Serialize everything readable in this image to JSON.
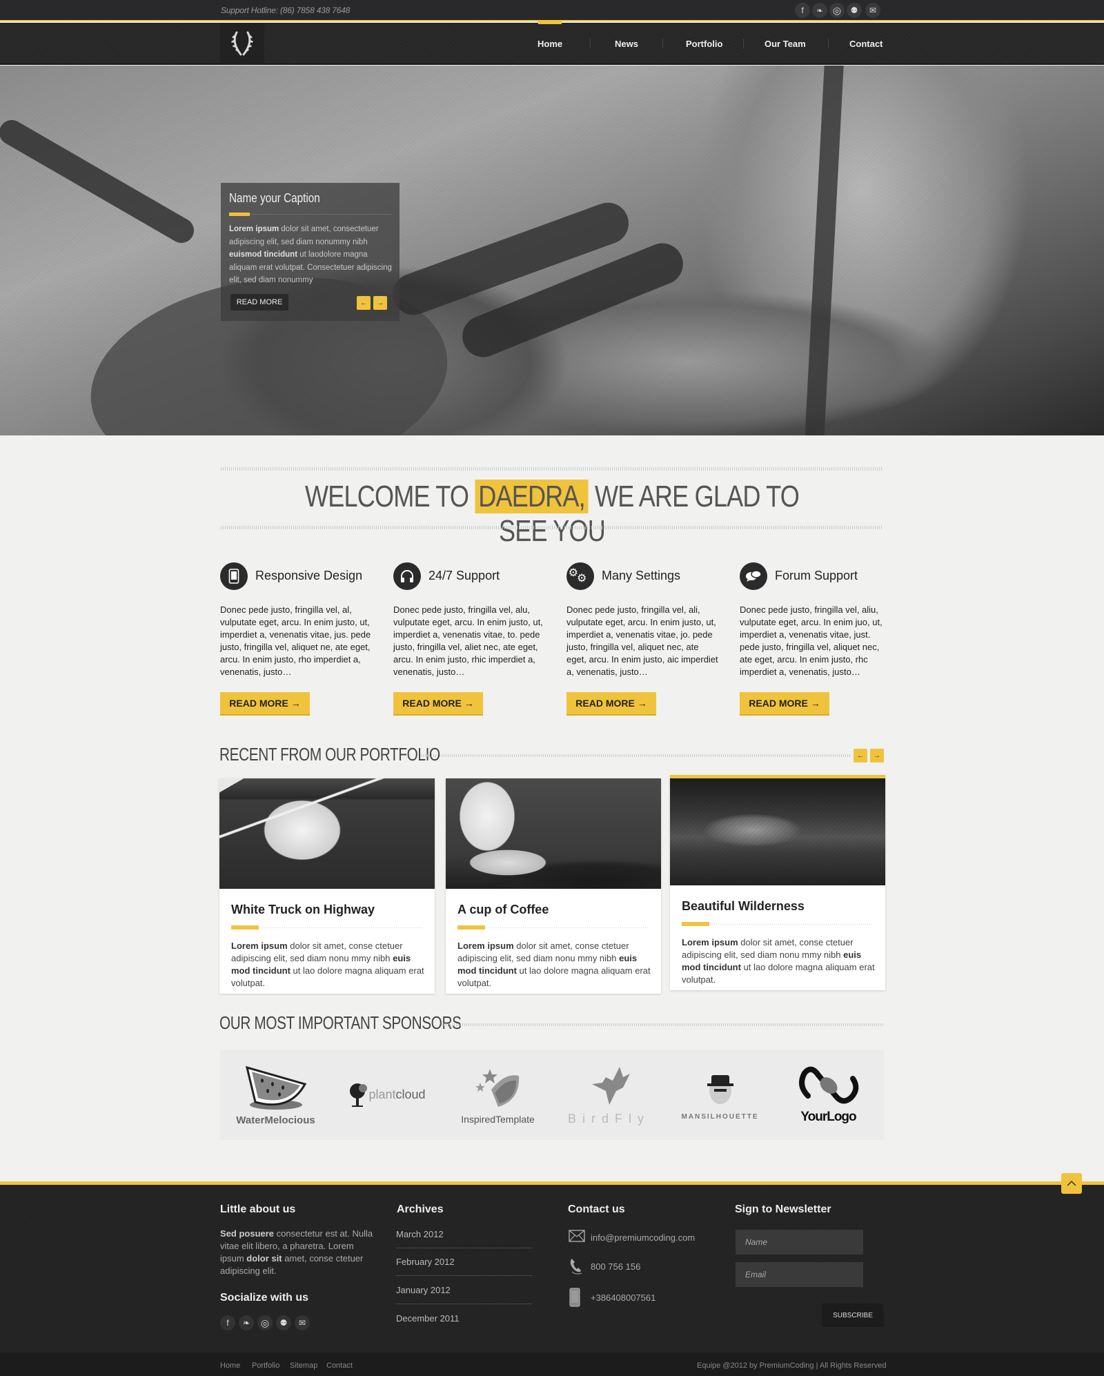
{
  "topbar": {
    "hotline": "Support Hotline: (86) 7858 438 7648",
    "social": [
      {
        "icon": "facebook-icon",
        "glyph": "f"
      },
      {
        "icon": "twitter-icon",
        "glyph": "🐦"
      },
      {
        "icon": "dribbble-icon",
        "glyph": "⊕"
      },
      {
        "icon": "forrst-icon",
        "glyph": "⚲"
      },
      {
        "icon": "email-icon",
        "glyph": "✉"
      }
    ]
  },
  "nav": {
    "logo": "laurel-logo",
    "items": [
      {
        "label": "Home",
        "active": true
      },
      {
        "label": "News",
        "active": false
      },
      {
        "label": "Portfolio",
        "active": false
      },
      {
        "label": "Our Team",
        "active": false
      },
      {
        "label": "Contact",
        "active": false
      }
    ]
  },
  "hero": {
    "caption_title": "Name your Caption",
    "caption_bold1": "Lorem ipsum",
    "caption_text1": " dolor sit amet, consectetuer adipiscing elit, sed diam nonummy nibh ",
    "caption_bold2": "euismod tincidunt",
    "caption_text2": " ut laodolore magna aliquam erat volutpat. Consectetuer adipiscing elit, sed diam nonummy",
    "read_more": "READ MORE",
    "prev": "←",
    "next": "→"
  },
  "welcome": {
    "pre": "WELCOME TO",
    "highlight": "DAEDRA,",
    "post": "WE ARE GLAD TO SEE YOU"
  },
  "features": [
    {
      "icon": "smartphone-icon",
      "glyph": "▯",
      "title": "Responsive Design",
      "text": "Donec pede justo, fringilla vel, al, vulputate eget, arcu. In enim justo, ut, imperdiet a, venenatis vitae, jus. pede justo, fringilla vel, aliquet ne, ate eget, arcu. In enim justo, rho imperdiet a, venenatis, justo…",
      "button": "READ MORE →"
    },
    {
      "icon": "headphones-icon",
      "glyph": "🎧",
      "title": "24/7 Support",
      "text": "Donec pede justo, fringilla vel, alu, vulputate eget, arcu. In enim justo, ut, imperdiet a, venenatis vitae, to. pede justo, fringilla vel, aliet nec, ate eget, arcu. In enim justo, rhic imperdiet a, venenatis, justo…",
      "button": "READ MORE →"
    },
    {
      "icon": "gears-icon",
      "glyph": "⚙",
      "title": "Many Settings",
      "text": "Donec pede justo, fringilla vel, ali, vulputate eget, arcu. In enim justo, ut, imperdiet a, venenatis vitae, jo. pede justo, fringilla vel, aliquet nec, ate eget, arcu. In enim justo, aic imperdiet a, venenatis, justo…",
      "button": "READ MORE →"
    },
    {
      "icon": "chat-bubbles-icon",
      "glyph": "💬",
      "title": "Forum Support",
      "text": "Donec pede justo, fringilla vel, aliu, vulputate eget, arcu. In enim juo, ut, imperdiet a, venenatis vitae, just. pede justo, fringilla vel, aliquet nec, ate eget, arcu. In enim justo, rhc imperdiet a, venenatis, justo…",
      "button": "READ MORE →"
    }
  ],
  "portfolio": {
    "title": "RECENT FROM OUR  PORTFOLIO",
    "prev": "←",
    "next": "→",
    "items": [
      {
        "title": "White Truck on Highway",
        "image": "truck-photo",
        "bold1": "Lorem ipsum",
        "text1": " dolor sit amet, conse ctetuer adipiscing elit, sed diam nonu mmy nibh ",
        "bold2": "euis mod tincidunt",
        "text2": " ut lao dolore magna aliquam erat volutpat.",
        "active": false
      },
      {
        "title": "A cup of Coffee",
        "image": "coffee-photo",
        "bold1": "Lorem ipsum",
        "text1": " dolor sit amet, conse ctetuer adipiscing elit, sed diam nonu mmy nibh ",
        "bold2": "euis mod tincidunt",
        "text2": " ut lao dolore magna aliquam erat volutpat.",
        "active": false
      },
      {
        "title": "Beautiful Wilderness",
        "image": "storm-photo",
        "bold1": "Lorem ipsum",
        "text1": " dolor sit amet, conse ctetuer adipiscing elit, sed diam nonu mmy nibh ",
        "bold2": "euis mod tincidunt",
        "text2": " ut lao dolore magna aliquam erat volutpat.",
        "active": true
      }
    ]
  },
  "sponsors": {
    "title": "OUR MOST IMPORTANT SPONSORS",
    "items": [
      {
        "name": "WaterMelocious",
        "icon": "watermelon-logo"
      },
      {
        "name": "plantcloud",
        "icon": "tree-logo"
      },
      {
        "name": "InspiredTemplate",
        "icon": "stars-logo"
      },
      {
        "name": "BirdFly",
        "icon": "bird-logo"
      },
      {
        "name": "MANSILHOUETTE",
        "icon": "hat-man-logo"
      },
      {
        "name": "YourLogo",
        "icon": "loop-logo"
      }
    ]
  },
  "footer": {
    "about": {
      "title": "Little about us",
      "bold1": "Sed posuere",
      "text1": " consectetur  est at. Nulla vitae elit libero, a pharetra. Lorem ipsum ",
      "bold2": "dolor sit",
      "text2": " amet, conse ctetuer adipiscing elit."
    },
    "social_title": "Socialize with us",
    "archives": {
      "title": "Archives",
      "items": [
        "March 2012",
        "February 2012",
        "January 2012",
        "December 2011"
      ]
    },
    "contact": {
      "title": "Contact us",
      "email": "info@premiumcoding.com",
      "phone": "800 756 156",
      "mobile": "+386408007561"
    },
    "newsletter": {
      "title": "Sign to Newsletter",
      "name_placeholder": "Name",
      "email_placeholder": "Email",
      "subscribe": "SUBSCRIBE"
    },
    "bottom_links": [
      "Home",
      "Portfolio",
      "Sitemap",
      "Contact"
    ],
    "copyright": "Equipe @2012 by PremiumCoding | All Rights Reserved",
    "to_top": "^"
  },
  "colors": {
    "accent": "#f0c33c",
    "dark": "#29292b",
    "light_bg": "#f1f1f0"
  }
}
